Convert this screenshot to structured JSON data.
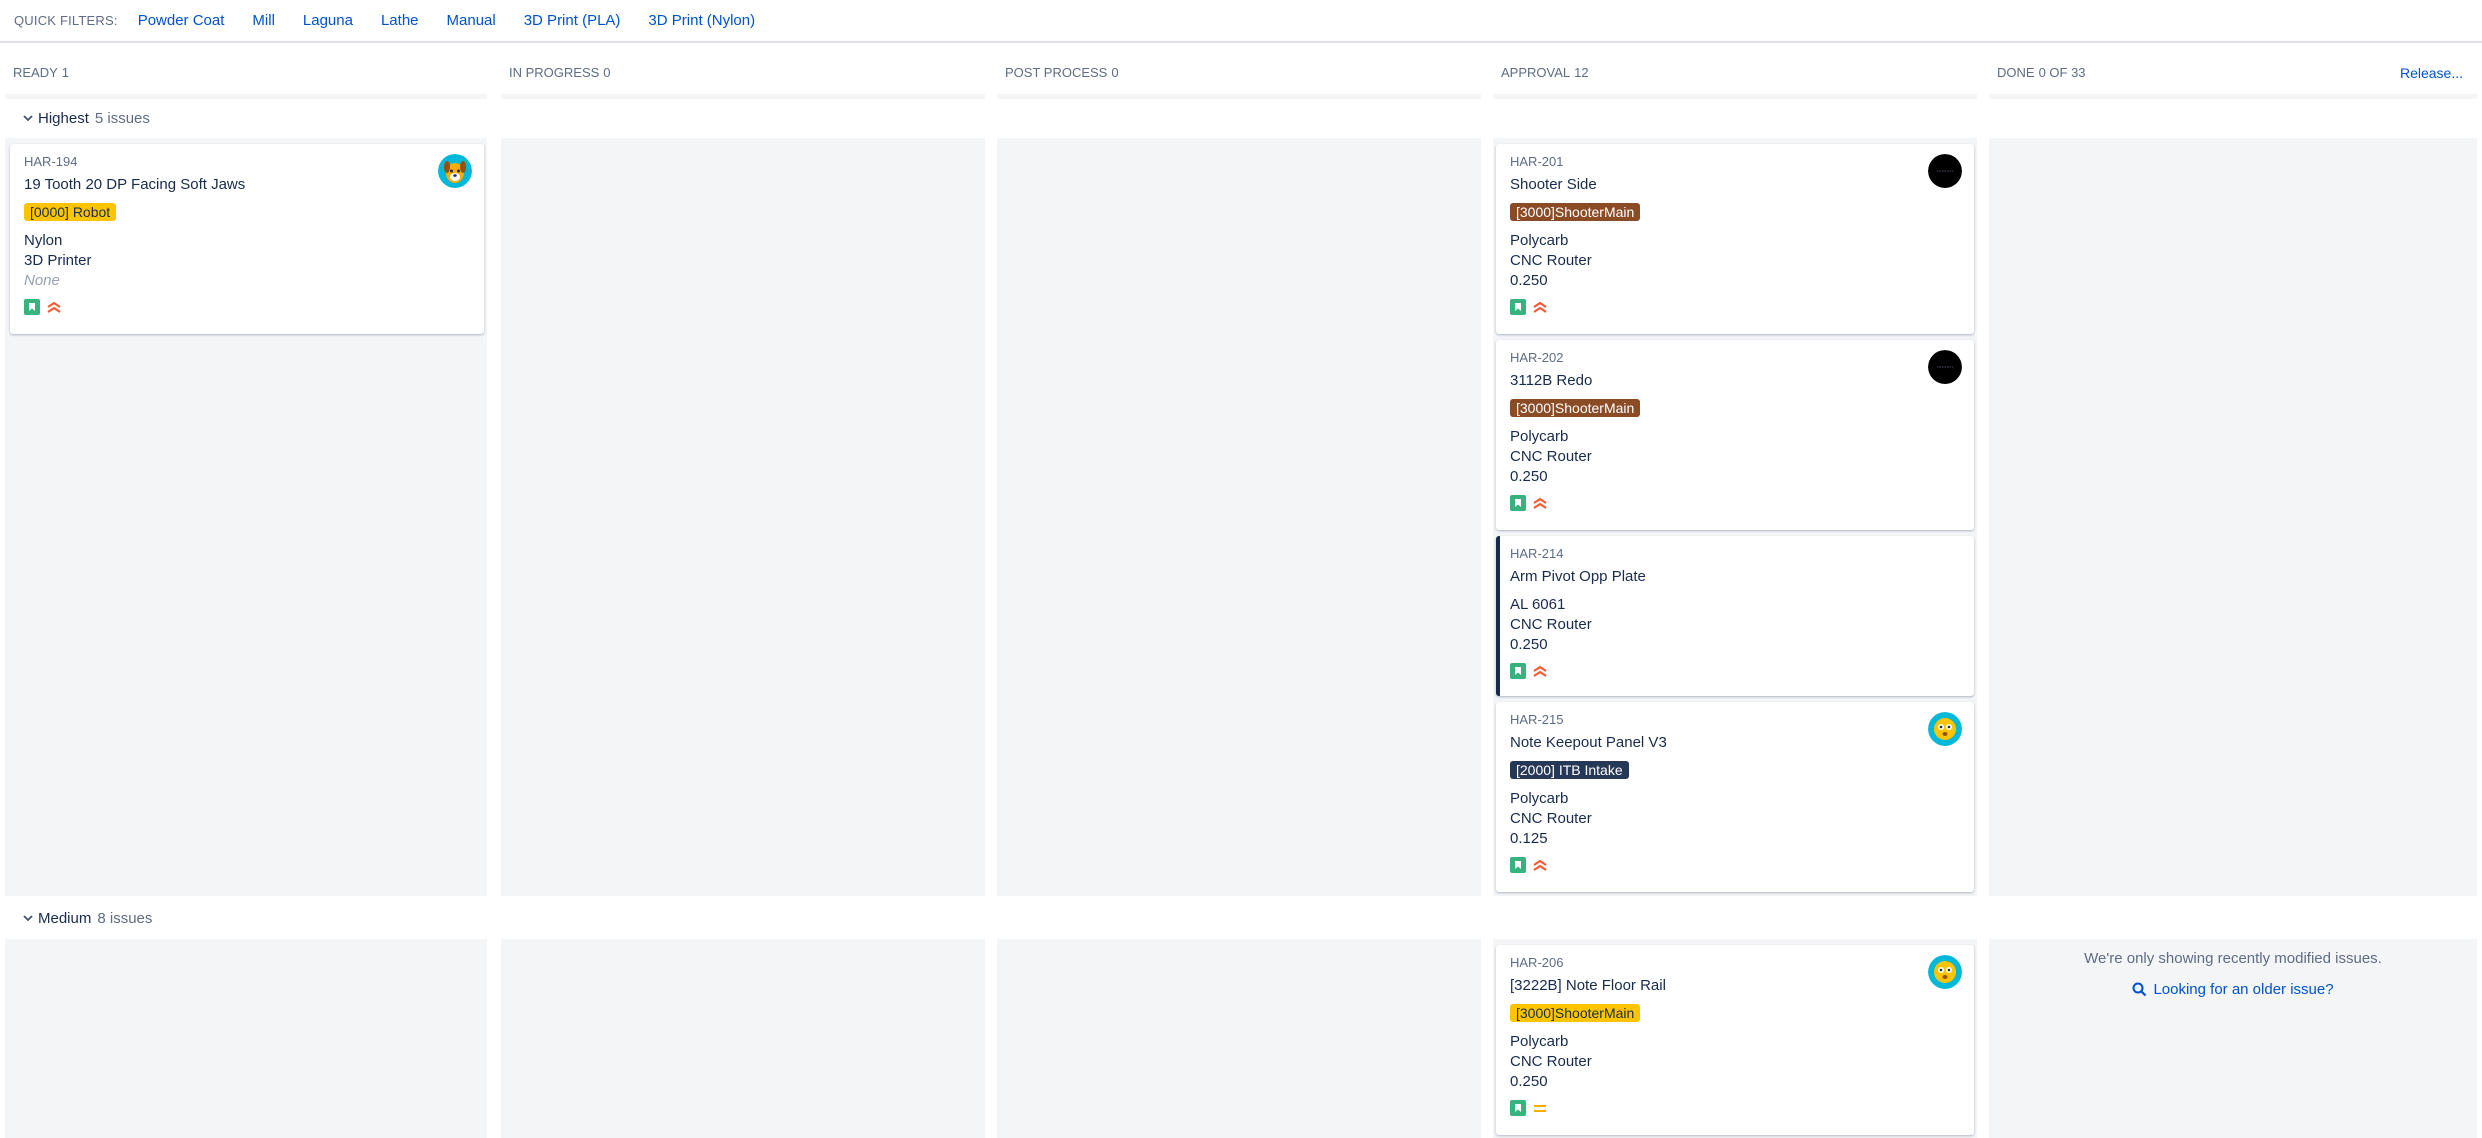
{
  "quick_filters": {
    "label": "QUICK FILTERS:",
    "items": [
      "Powder Coat",
      "Mill",
      "Laguna",
      "Lathe",
      "Manual",
      "3D Print (PLA)",
      "3D Print (Nylon)"
    ]
  },
  "columns": [
    {
      "name": "READY",
      "count": "1"
    },
    {
      "name": "IN PROGRESS",
      "count": "0"
    },
    {
      "name": "POST PROCESS",
      "count": "0"
    },
    {
      "name": "APPROVAL",
      "count": "12"
    },
    {
      "name": "DONE",
      "count": "0 OF 33"
    }
  ],
  "release_label": "Release...",
  "lanes": [
    {
      "name": "Highest",
      "issues": "5 issues"
    },
    {
      "name": "Medium",
      "issues": "8 issues"
    }
  ],
  "cards": {
    "har194": {
      "key": "HAR-194",
      "summary": "19 Tooth 20 DP Facing Soft Jaws",
      "epic": "[0000] Robot",
      "f1": "Nylon",
      "f2": "3D Printer",
      "f3": "None"
    },
    "har201": {
      "key": "HAR-201",
      "summary": "Shooter Side",
      "epic": "[3000]ShooterMain",
      "f1": "Polycarb",
      "f2": "CNC Router",
      "f3": "0.250"
    },
    "har202": {
      "key": "HAR-202",
      "summary": "3112B Redo",
      "epic": "[3000]ShooterMain",
      "f1": "Polycarb",
      "f2": "CNC Router",
      "f3": "0.250"
    },
    "har214": {
      "key": "HAR-214",
      "summary": "Arm Pivot Opp Plate",
      "f1": "AL 6061",
      "f2": "CNC Router",
      "f3": "0.250"
    },
    "har215": {
      "key": "HAR-215",
      "summary": "Note Keepout Panel V3",
      "epic": "[2000] ITB Intake",
      "f1": "Polycarb",
      "f2": "CNC Router",
      "f3": "0.125"
    },
    "har206": {
      "key": "HAR-206",
      "summary": "[3222B] Note Floor Rail",
      "epic": "[3000]ShooterMain",
      "f1": "Polycarb",
      "f2": "CNC Router",
      "f3": "0.250"
    }
  },
  "colors": {
    "epic_robot": "#ffc400",
    "epic_shooter_brown": "#8b4b25",
    "epic_itb": "#253858",
    "epic_shooter_yellow": "#ffc400",
    "story": "#36b37e",
    "priority_highest": "#ff5630",
    "priority_medium": "#ffab00"
  },
  "older_issues": {
    "message": "We're only showing recently modified issues.",
    "link": "Looking for an older issue?"
  }
}
